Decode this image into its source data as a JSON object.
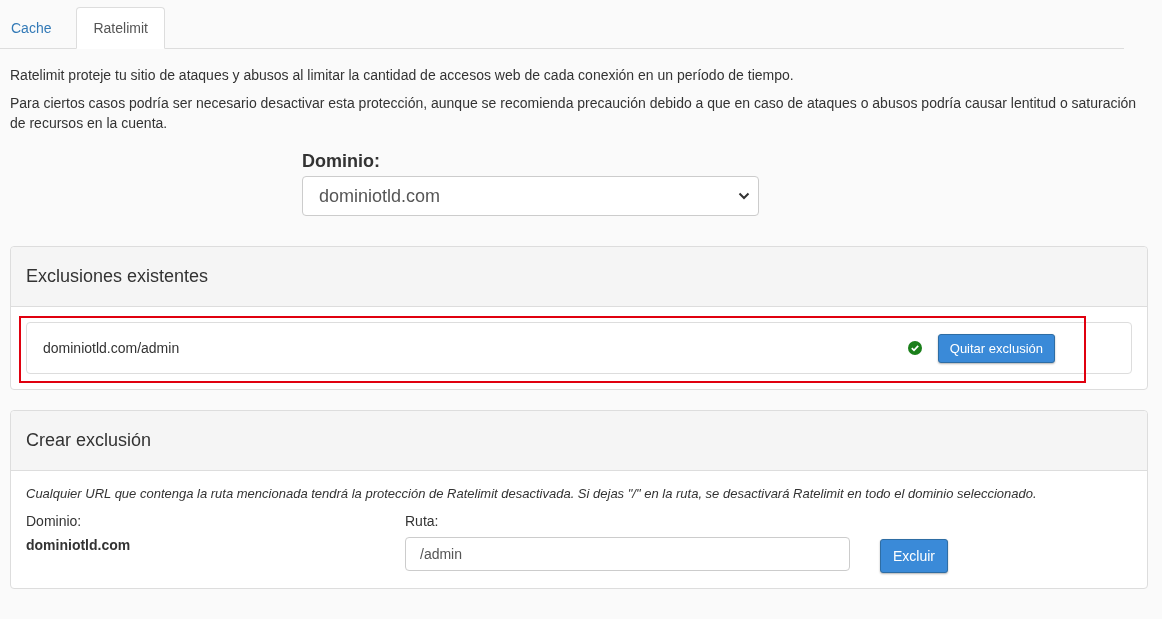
{
  "tabs": [
    {
      "label": "Cache",
      "selected": false
    },
    {
      "label": "Ratelimit",
      "selected": true
    }
  ],
  "intro": [
    "Ratelimit proteje tu sitio de ataques y abusos al limitar la cantidad de accesos web de cada conexión en un período de tiempo.",
    "Para ciertos casos podría ser necesario desactivar esta protección, aunque se recomienda precaución debido a que en caso de ataques o abusos podría causar lentitud o saturación de recursos en la cuenta."
  ],
  "domain_select": {
    "label": "Dominio:",
    "value": "dominiotld.com"
  },
  "exclusions": {
    "title": "Exclusiones existentes",
    "items": [
      {
        "path": "dominiotld.com/admin",
        "active": true,
        "button": "Quitar exclusión"
      }
    ]
  },
  "create": {
    "title": "Crear exclusión",
    "note": "Cualquier URL que contenga la ruta mencionada tendrá la protección de Ratelimit desactivada. Si dejas \"/\" en la ruta, se desactivará Ratelimit en todo el dominio seleccionado.",
    "domain_label": "Dominio:",
    "domain_value": "dominiotld.com",
    "path_label": "Ruta:",
    "path_value": "/admin",
    "button": "Excluir"
  }
}
